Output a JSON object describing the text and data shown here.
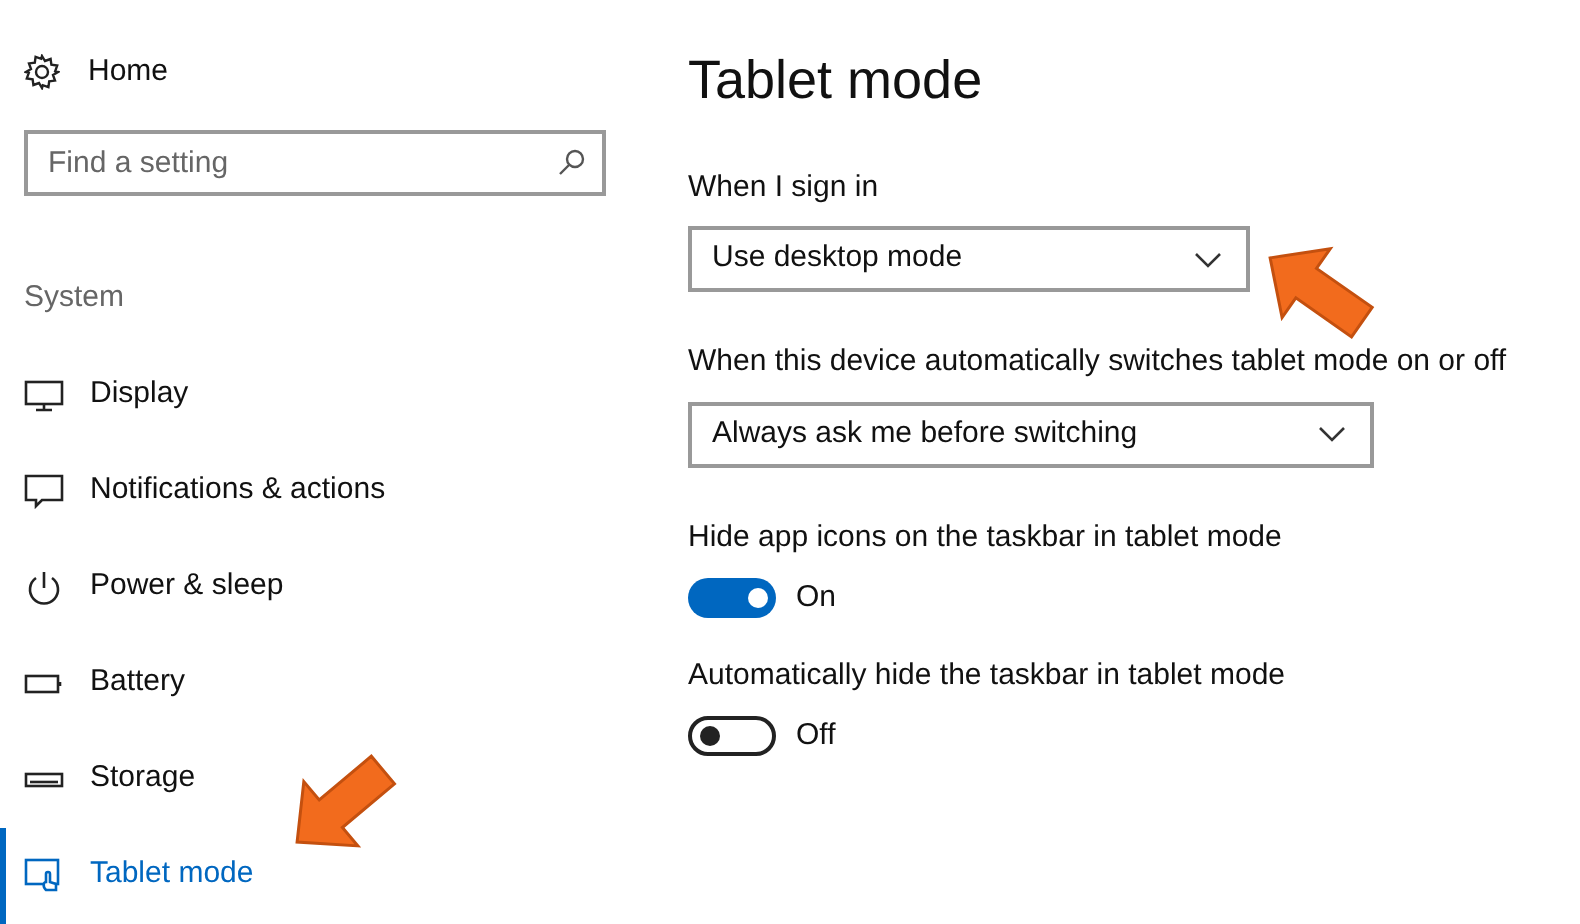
{
  "sidebar": {
    "home": "Home",
    "search": {
      "placeholder": "Find a setting"
    },
    "section": "System",
    "items": [
      {
        "label": "Display",
        "selected": false
      },
      {
        "label": "Notifications & actions",
        "selected": false
      },
      {
        "label": "Power & sleep",
        "selected": false
      },
      {
        "label": "Battery",
        "selected": false
      },
      {
        "label": "Storage",
        "selected": false
      },
      {
        "label": "Tablet mode",
        "selected": true
      }
    ]
  },
  "page": {
    "title": "Tablet mode",
    "settings": [
      {
        "kind": "dropdown",
        "label": "When I sign in",
        "value": "Use desktop mode"
      },
      {
        "kind": "dropdown",
        "label": "When this device automatically switches tablet mode on or off",
        "value": "Always ask me before switching"
      },
      {
        "kind": "toggle",
        "label": "Hide app icons on the taskbar in tablet mode",
        "on": true,
        "state": "On"
      },
      {
        "kind": "toggle",
        "label": "Automatically hide the taskbar in tablet mode",
        "on": false,
        "state": "Off"
      }
    ]
  }
}
